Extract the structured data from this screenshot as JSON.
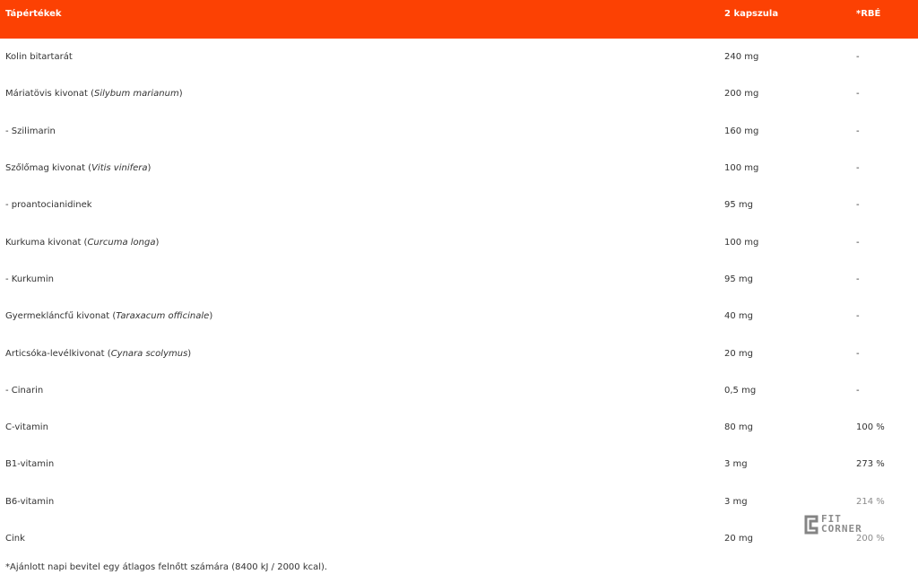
{
  "table": {
    "headers": {
      "name": "Tápértékek",
      "amount": "2 kapszula",
      "rbe": "*RBÉ"
    },
    "rows": [
      {
        "name": "Kolin bitartarát",
        "latin": "",
        "suffix": "",
        "amount": "240 mg",
        "rbe": "-"
      },
      {
        "name": "Máriatövis kivonat (",
        "latin": "Silybum marianum",
        "suffix": ")",
        "amount": "200 mg",
        "rbe": "-"
      },
      {
        "name": "- Szilimarin",
        "latin": "",
        "suffix": "",
        "amount": "160 mg",
        "rbe": "-"
      },
      {
        "name": "Szőlőmag kivonat (",
        "latin": "Vitis vinifera",
        "suffix": ")",
        "amount": "100 mg",
        "rbe": "-"
      },
      {
        "name": "- proantocianidinek",
        "latin": "",
        "suffix": "",
        "amount": "95 mg",
        "rbe": "-"
      },
      {
        "name": "Kurkuma kivonat (",
        "latin": "Curcuma longa",
        "suffix": ")",
        "amount": "100 mg",
        "rbe": "-"
      },
      {
        "name": "- Kurkumin",
        "latin": "",
        "suffix": "",
        "amount": "95 mg",
        "rbe": "-"
      },
      {
        "name": "Gyermekláncfű kivonat (",
        "latin": "Taraxacum officinale",
        "suffix": ")",
        "amount": "40 mg",
        "rbe": "-"
      },
      {
        "name": "Articsóka-levélkivonat (",
        "latin": "Cynara scolymus",
        "suffix": ")",
        "amount": "20 mg",
        "rbe": "-"
      },
      {
        "name": "- Cinarin",
        "latin": "",
        "suffix": "",
        "amount": "0,5 mg",
        "rbe": "-"
      },
      {
        "name": "C-vitamin",
        "latin": "",
        "suffix": "",
        "amount": "80 mg",
        "rbe": "100 %"
      },
      {
        "name": "B1-vitamin",
        "latin": "",
        "suffix": "",
        "amount": "3 mg",
        "rbe": "273 %"
      },
      {
        "name": "B6-vitamin",
        "latin": "",
        "suffix": "",
        "amount": "3 mg",
        "rbe": "214 %"
      },
      {
        "name": "Cink",
        "latin": "",
        "suffix": "",
        "amount": "20 mg",
        "rbe": "200 %"
      }
    ]
  },
  "footnote": "*Ajánlott napi bevitel egy átlagos felnőtt számára (8400 kJ / 2000 kcal).",
  "watermark": {
    "line1": "FIT",
    "line2": "CORNER"
  },
  "colors": {
    "header_bg": "#fc4103",
    "header_text": "#ffffff",
    "body_text": "#333333"
  }
}
